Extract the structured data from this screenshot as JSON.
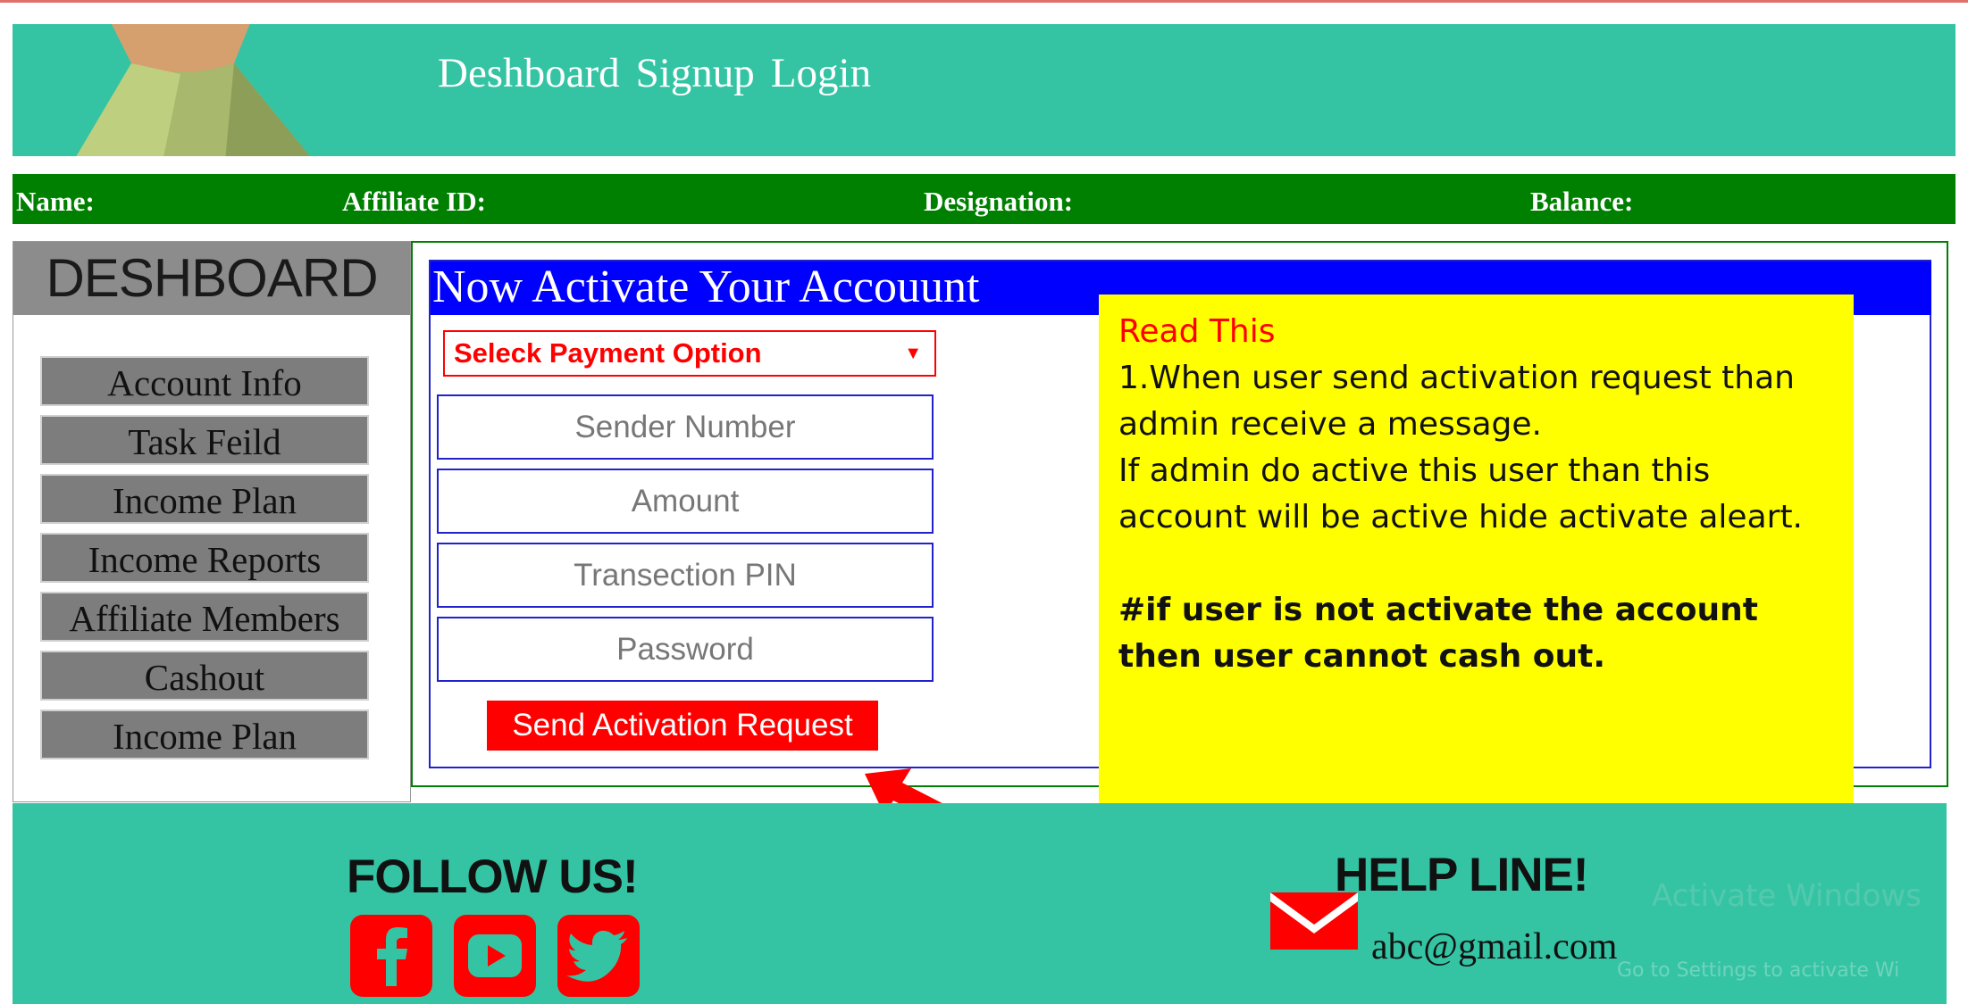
{
  "nav": [
    "Deshboard",
    "Signup",
    "Login"
  ],
  "infobar": {
    "name_label": "Name:",
    "affiliate_label": "Affiliate ID:",
    "designation_label": "Designation:",
    "balance_label": "Balance:"
  },
  "sidebar": {
    "title": "DESHBOARD",
    "items": [
      "Account Info",
      "Task Feild",
      "Income Plan",
      "Income Reports",
      "Affiliate Members",
      "Cashout",
      "Income Plan"
    ]
  },
  "form": {
    "heading": "Now Activate Your Accouunt",
    "select_value": "Seleck Payment Option",
    "fields": [
      "Sender Number",
      "Amount",
      "Transection PIN",
      "Password"
    ],
    "submit_label": "Send Activation Request"
  },
  "note": {
    "title": "Read This",
    "line1": "1.When  user send activation request than admin receive a message.",
    "line2": "If admin do active this user than this account will be active hide activate aleart.",
    "line3": "#if user is not activate the account then user cannot cash out."
  },
  "annotation": {
    "number": "1",
    "color": "#ff0000"
  },
  "footer": {
    "follow_title": "FOLLOW US!",
    "social_icons": [
      "facebook-icon",
      "youtube-icon",
      "twitter-icon"
    ],
    "help_title": "HELP LINE!",
    "email": "abc@gmail.com"
  },
  "watermark": {
    "line1": "Activate Windows",
    "line2": "Go to Settings to activate Wi"
  },
  "colors": {
    "teal": "#34c4a4",
    "green": "#008000",
    "blue": "#0000ff",
    "red": "#ff0000",
    "yellow": "#ffff00"
  }
}
